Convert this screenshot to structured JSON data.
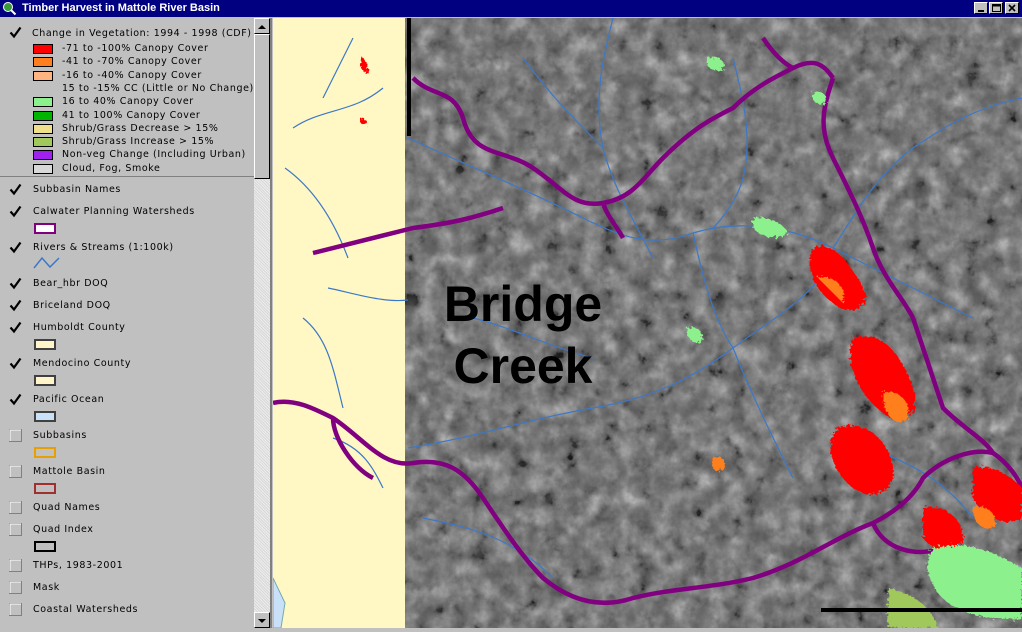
{
  "window": {
    "title": "Timber Harvest in Mattole River Basin",
    "icon": "globe-search-icon",
    "controls": [
      "minimize-icon",
      "maximize-icon",
      "close-icon"
    ]
  },
  "legend": {
    "title": "Change in Vegetation: 1994 - 1998 (CDF)",
    "checked": true,
    "classes": [
      {
        "label": "-71 to -100% Canopy Cover",
        "color": "#ff0000"
      },
      {
        "label": "-41 to -70% Canopy Cover",
        "color": "#ff7f1e"
      },
      {
        "label": "-16 to -40% Canopy Cover",
        "color": "#ffb380"
      },
      {
        "label": "15 to -15% CC (Little or No Change)",
        "color": null
      },
      {
        "label": "16 to 40% Canopy Cover",
        "color": "#8cf08c"
      },
      {
        "label": "41 to 100% Canopy Cover",
        "color": "#00b400"
      },
      {
        "label": "Shrub/Grass Decrease > 15%",
        "color": "#f0e08c"
      },
      {
        "label": "Shrub/Grass Increase > 15%",
        "color": "#a0c85a"
      },
      {
        "label": "Non-veg Change (Including Urban)",
        "color": "#a020f0"
      },
      {
        "label": "Cloud, Fog, Smoke",
        "color": "#d8d8d8"
      }
    ]
  },
  "layers": [
    {
      "name": "Subbasin Names",
      "checked": true,
      "symbol": "none"
    },
    {
      "name": "Calwater Planning Watersheds",
      "checked": true,
      "symbol": "polygon",
      "fill": "#ffffff",
      "stroke": "#800080"
    },
    {
      "name": "Rivers & Streams (1:100k)",
      "checked": true,
      "symbol": "line",
      "stroke": "#3c78c8"
    },
    {
      "name": "Bear_hbr DOQ",
      "checked": true,
      "symbol": "none"
    },
    {
      "name": "Briceland DOQ",
      "checked": true,
      "symbol": "none"
    },
    {
      "name": "Humboldt County",
      "checked": true,
      "symbol": "polygon",
      "fill": "#fff5c8",
      "stroke": "#404040"
    },
    {
      "name": "Mendocino County",
      "checked": true,
      "symbol": "polygon",
      "fill": "#fff5c8",
      "stroke": "#404040"
    },
    {
      "name": "Pacific Ocean",
      "checked": true,
      "symbol": "polygon",
      "fill": "#c8e0f8",
      "stroke": "#404040"
    },
    {
      "name": "Subbasins",
      "checked": false,
      "symbol": "polygon",
      "fill": "#c0c0c0",
      "stroke": "#e8a000"
    },
    {
      "name": "Mattole Basin",
      "checked": false,
      "symbol": "polygon",
      "fill": "#c0c0c0",
      "stroke": "#a03030"
    },
    {
      "name": "Quad Names",
      "checked": false,
      "symbol": "none"
    },
    {
      "name": "Quad Index",
      "checked": false,
      "symbol": "polygon",
      "fill": "#c0c0c0",
      "stroke": "#000000"
    },
    {
      "name": "THPs, 1983-2001",
      "checked": false,
      "symbol": "none"
    },
    {
      "name": "Mask",
      "checked": false,
      "symbol": "none"
    },
    {
      "name": "Coastal Watersheds",
      "checked": false,
      "symbol": "none"
    }
  ],
  "map": {
    "label_line1": "Bridge",
    "label_line2": "Creek",
    "colors": {
      "land": "#fff8c4",
      "watershed_boundary": "#800080",
      "streams": "#3c78c8",
      "canopy_loss_high": "#ff0000",
      "canopy_loss_mid": "#ff7f1e",
      "canopy_gain": "#8cf08c"
    }
  }
}
